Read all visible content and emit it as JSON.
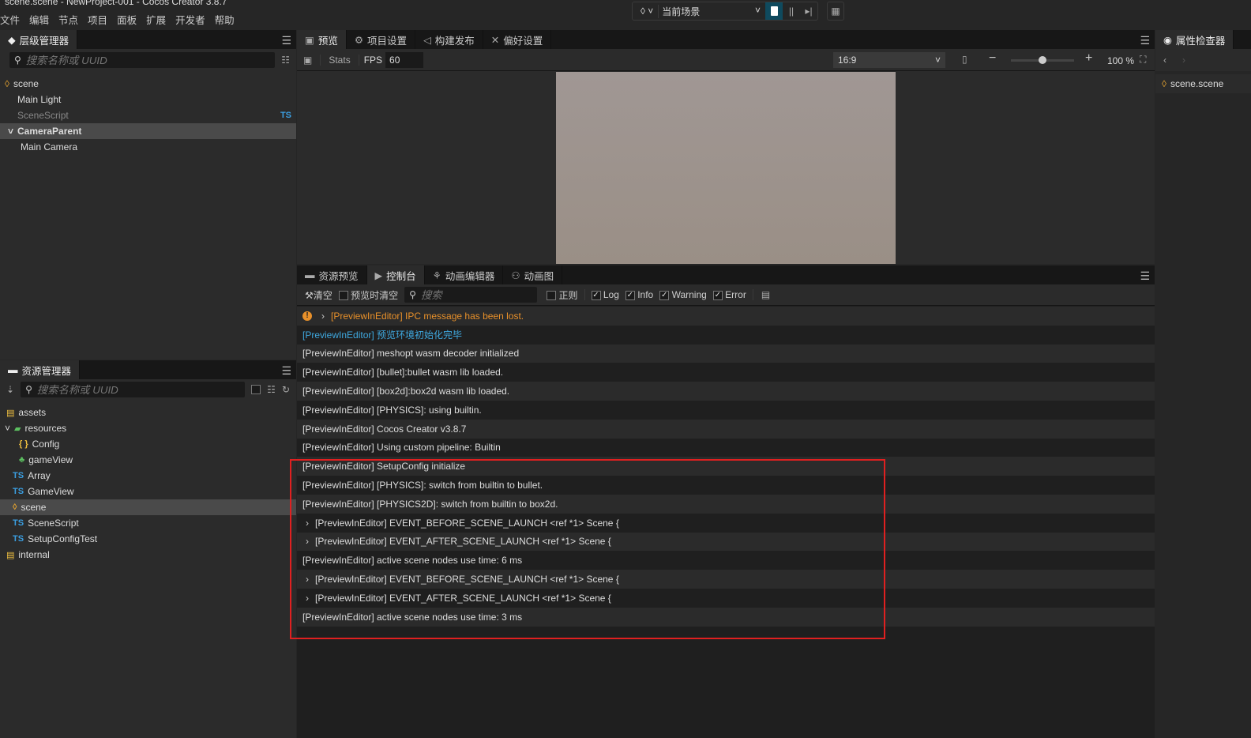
{
  "window": {
    "title": "scene.scene - NewProject-001 - Cocos Creator 3.8.7"
  },
  "menu": [
    "文件",
    "编辑",
    "节点",
    "项目",
    "面板",
    "扩展",
    "开发者",
    "帮助"
  ],
  "toolbar": {
    "scene_select": "当前场景"
  },
  "hierarchy": {
    "tab": "层级管理器",
    "search_placeholder": "搜索名称或 UUID",
    "nodes": [
      {
        "label": "scene",
        "icon": "scene-icon"
      },
      {
        "label": "Main Light"
      },
      {
        "label": "SceneScript",
        "badge": "TS"
      },
      {
        "label": "CameraParent",
        "selected": true
      },
      {
        "label": "Main Camera"
      }
    ]
  },
  "assets": {
    "tab": "资源管理器",
    "search_placeholder": "搜索名称或 UUID",
    "items": [
      {
        "label": "assets",
        "icon": "db-icon"
      },
      {
        "label": "resources",
        "icon": "folder-icon"
      },
      {
        "label": "Config",
        "icon": "json-icon"
      },
      {
        "label": "gameView",
        "icon": "prefab-icon"
      },
      {
        "label": "Array",
        "icon": "ts"
      },
      {
        "label": "GameView",
        "icon": "ts"
      },
      {
        "label": "scene",
        "icon": "scene-icon",
        "selected": true
      },
      {
        "label": "SceneScript",
        "icon": "ts"
      },
      {
        "label": "SetupConfigTest",
        "icon": "ts"
      },
      {
        "label": "internal",
        "icon": "db-icon"
      }
    ]
  },
  "preview": {
    "tabs": [
      "预览",
      "项目设置",
      "构建发布",
      "偏好设置"
    ],
    "stats": "Stats",
    "fps_label": "FPS",
    "fps": "60",
    "ratio": "16:9",
    "zoom": "100 %",
    "zoom_slider": 0.5
  },
  "console": {
    "tabs": [
      "资源预览",
      "控制台",
      "动画编辑器",
      "动画图"
    ],
    "clear": "清空",
    "clear_on_preview": "预览时清空",
    "search_placeholder": "搜索",
    "regex": "正则",
    "filters": [
      {
        "label": "Log",
        "checked": true
      },
      {
        "label": "Info",
        "checked": true
      },
      {
        "label": "Warning",
        "checked": true
      },
      {
        "label": "Error",
        "checked": true
      }
    ],
    "logs": [
      {
        "text": "[PreviewInEditor] IPC message has been lost.",
        "type": "warning",
        "expandable": true
      },
      {
        "text": "[PreviewInEditor] 预览环境初始化完毕",
        "type": "info"
      },
      {
        "text": "[PreviewInEditor] meshopt wasm decoder initialized"
      },
      {
        "text": "[PreviewInEditor] [bullet]:bullet wasm lib loaded."
      },
      {
        "text": "[PreviewInEditor] [box2d]:box2d wasm lib loaded."
      },
      {
        "text": "[PreviewInEditor] [PHYSICS]: using builtin."
      },
      {
        "text": "[PreviewInEditor] Cocos Creator v3.8.7"
      },
      {
        "text": "[PreviewInEditor] Using custom pipeline: Builtin"
      },
      {
        "text": "[PreviewInEditor] SetupConfig initialize"
      },
      {
        "text": "[PreviewInEditor] [PHYSICS]: switch from builtin to bullet."
      },
      {
        "text": "[PreviewInEditor] [PHYSICS2D]: switch from builtin to box2d."
      },
      {
        "text": "[PreviewInEditor] EVENT_BEFORE_SCENE_LAUNCH <ref *1> Scene {",
        "expandable": true
      },
      {
        "text": "[PreviewInEditor] EVENT_AFTER_SCENE_LAUNCH <ref *1> Scene {",
        "expandable": true
      },
      {
        "text": "[PreviewInEditor] active scene nodes use time: 6 ms"
      },
      {
        "text": "[PreviewInEditor] EVENT_BEFORE_SCENE_LAUNCH <ref *1> Scene {",
        "expandable": true
      },
      {
        "text": "[PreviewInEditor] EVENT_AFTER_SCENE_LAUNCH <ref *1> Scene {",
        "expandable": true
      },
      {
        "text": "[PreviewInEditor] active scene nodes use time: 3 ms"
      }
    ]
  },
  "inspector": {
    "tab": "属性检查器",
    "item": "scene.scene"
  },
  "colors": {
    "warning": "#e8902a",
    "info": "#3fa9e0",
    "highlight": "#e02020",
    "ts": "#3b9ee0"
  }
}
